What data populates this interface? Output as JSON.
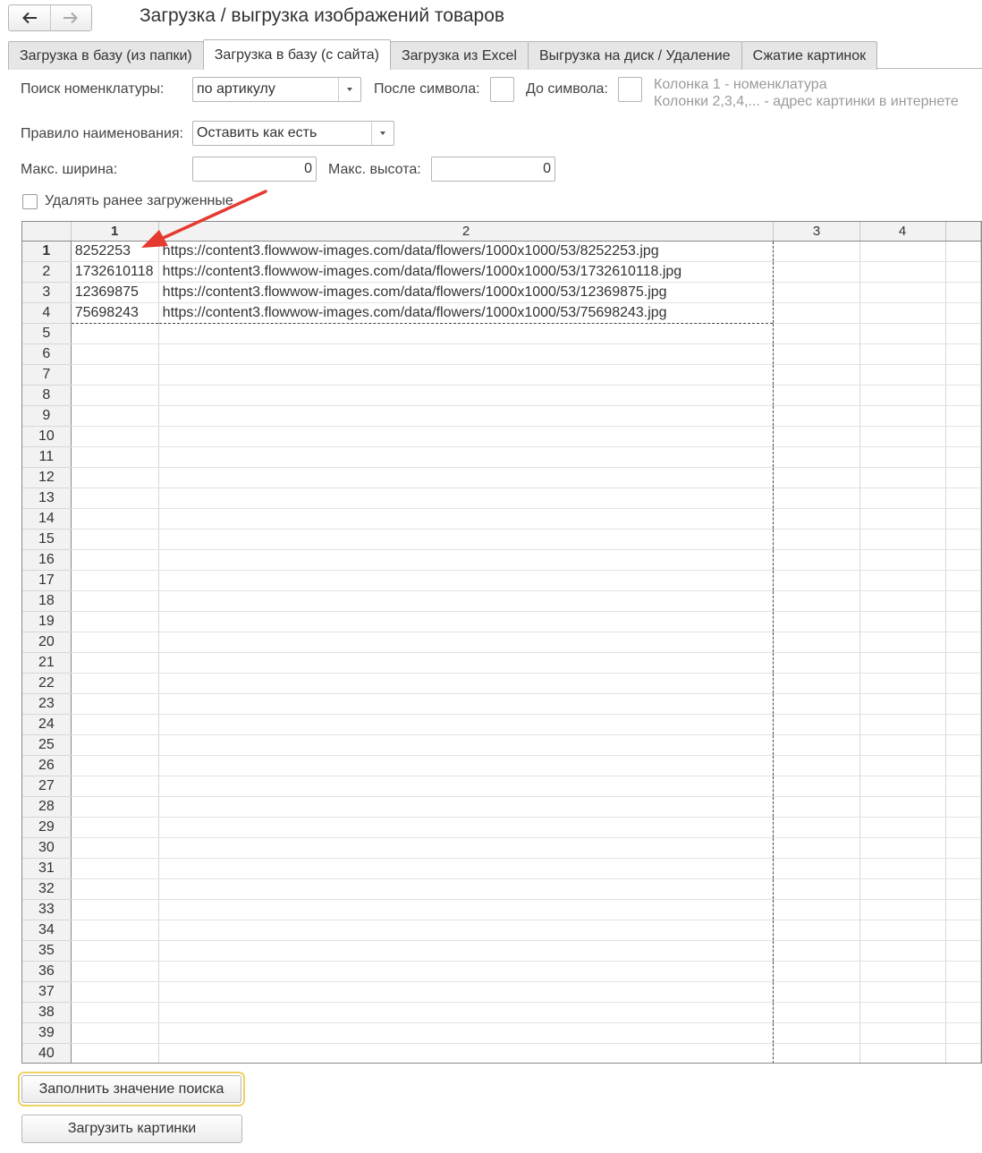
{
  "window": {
    "title": "Загрузка / выгрузка изображений товаров",
    "nav": {
      "back_icon": "arrow-left-icon",
      "forward_icon": "arrow-right-icon"
    }
  },
  "tabs": [
    {
      "label": "Загрузка в базу (из папки)",
      "active": false
    },
    {
      "label": "Загрузка в базу (с сайта)",
      "active": true
    },
    {
      "label": "Загрузка из Excel",
      "active": false
    },
    {
      "label": "Выгрузка на диск / Удаление",
      "active": false
    },
    {
      "label": "Сжатие картинок",
      "active": false
    }
  ],
  "form": {
    "search_label": "Поиск номенклатуры:",
    "search_value": "по артикулу",
    "after_label": "После символа:",
    "after_value": "",
    "before_label": "До символа:",
    "before_value": "",
    "hint_line1": "Колонка 1 - номенклатура",
    "hint_line2": "Колонки 2,3,4,... - адрес картинки в интернете",
    "naming_label": "Правило наименования:",
    "naming_value": "Оставить как есть",
    "max_width_label": "Макс. ширина:",
    "max_width_value": "0",
    "max_height_label": "Макс. высота:",
    "max_height_value": "0",
    "delete_checkbox_label": "Удалять ранее загруженные",
    "delete_checked": false
  },
  "grid": {
    "columns": [
      "1",
      "2",
      "3",
      "4"
    ],
    "rows": [
      [
        "8252253",
        "https://content3.flowwow-images.com/data/flowers/1000x1000/53/8252253.jpg"
      ],
      [
        "1732610118",
        "https://content3.flowwow-images.com/data/flowers/1000x1000/53/1732610118.jpg"
      ],
      [
        "12369875",
        "https://content3.flowwow-images.com/data/flowers/1000x1000/53/12369875.jpg"
      ],
      [
        "75698243",
        "https://content3.flowwow-images.com/data/flowers/1000x1000/53/75698243.jpg"
      ]
    ],
    "row_count": 40,
    "selected_row": 1,
    "selected_column": 1
  },
  "annotation": {
    "color": "#e53a2f"
  },
  "buttons": {
    "fill": "Заполнить значение поиска",
    "load": "Загрузить картинки"
  }
}
